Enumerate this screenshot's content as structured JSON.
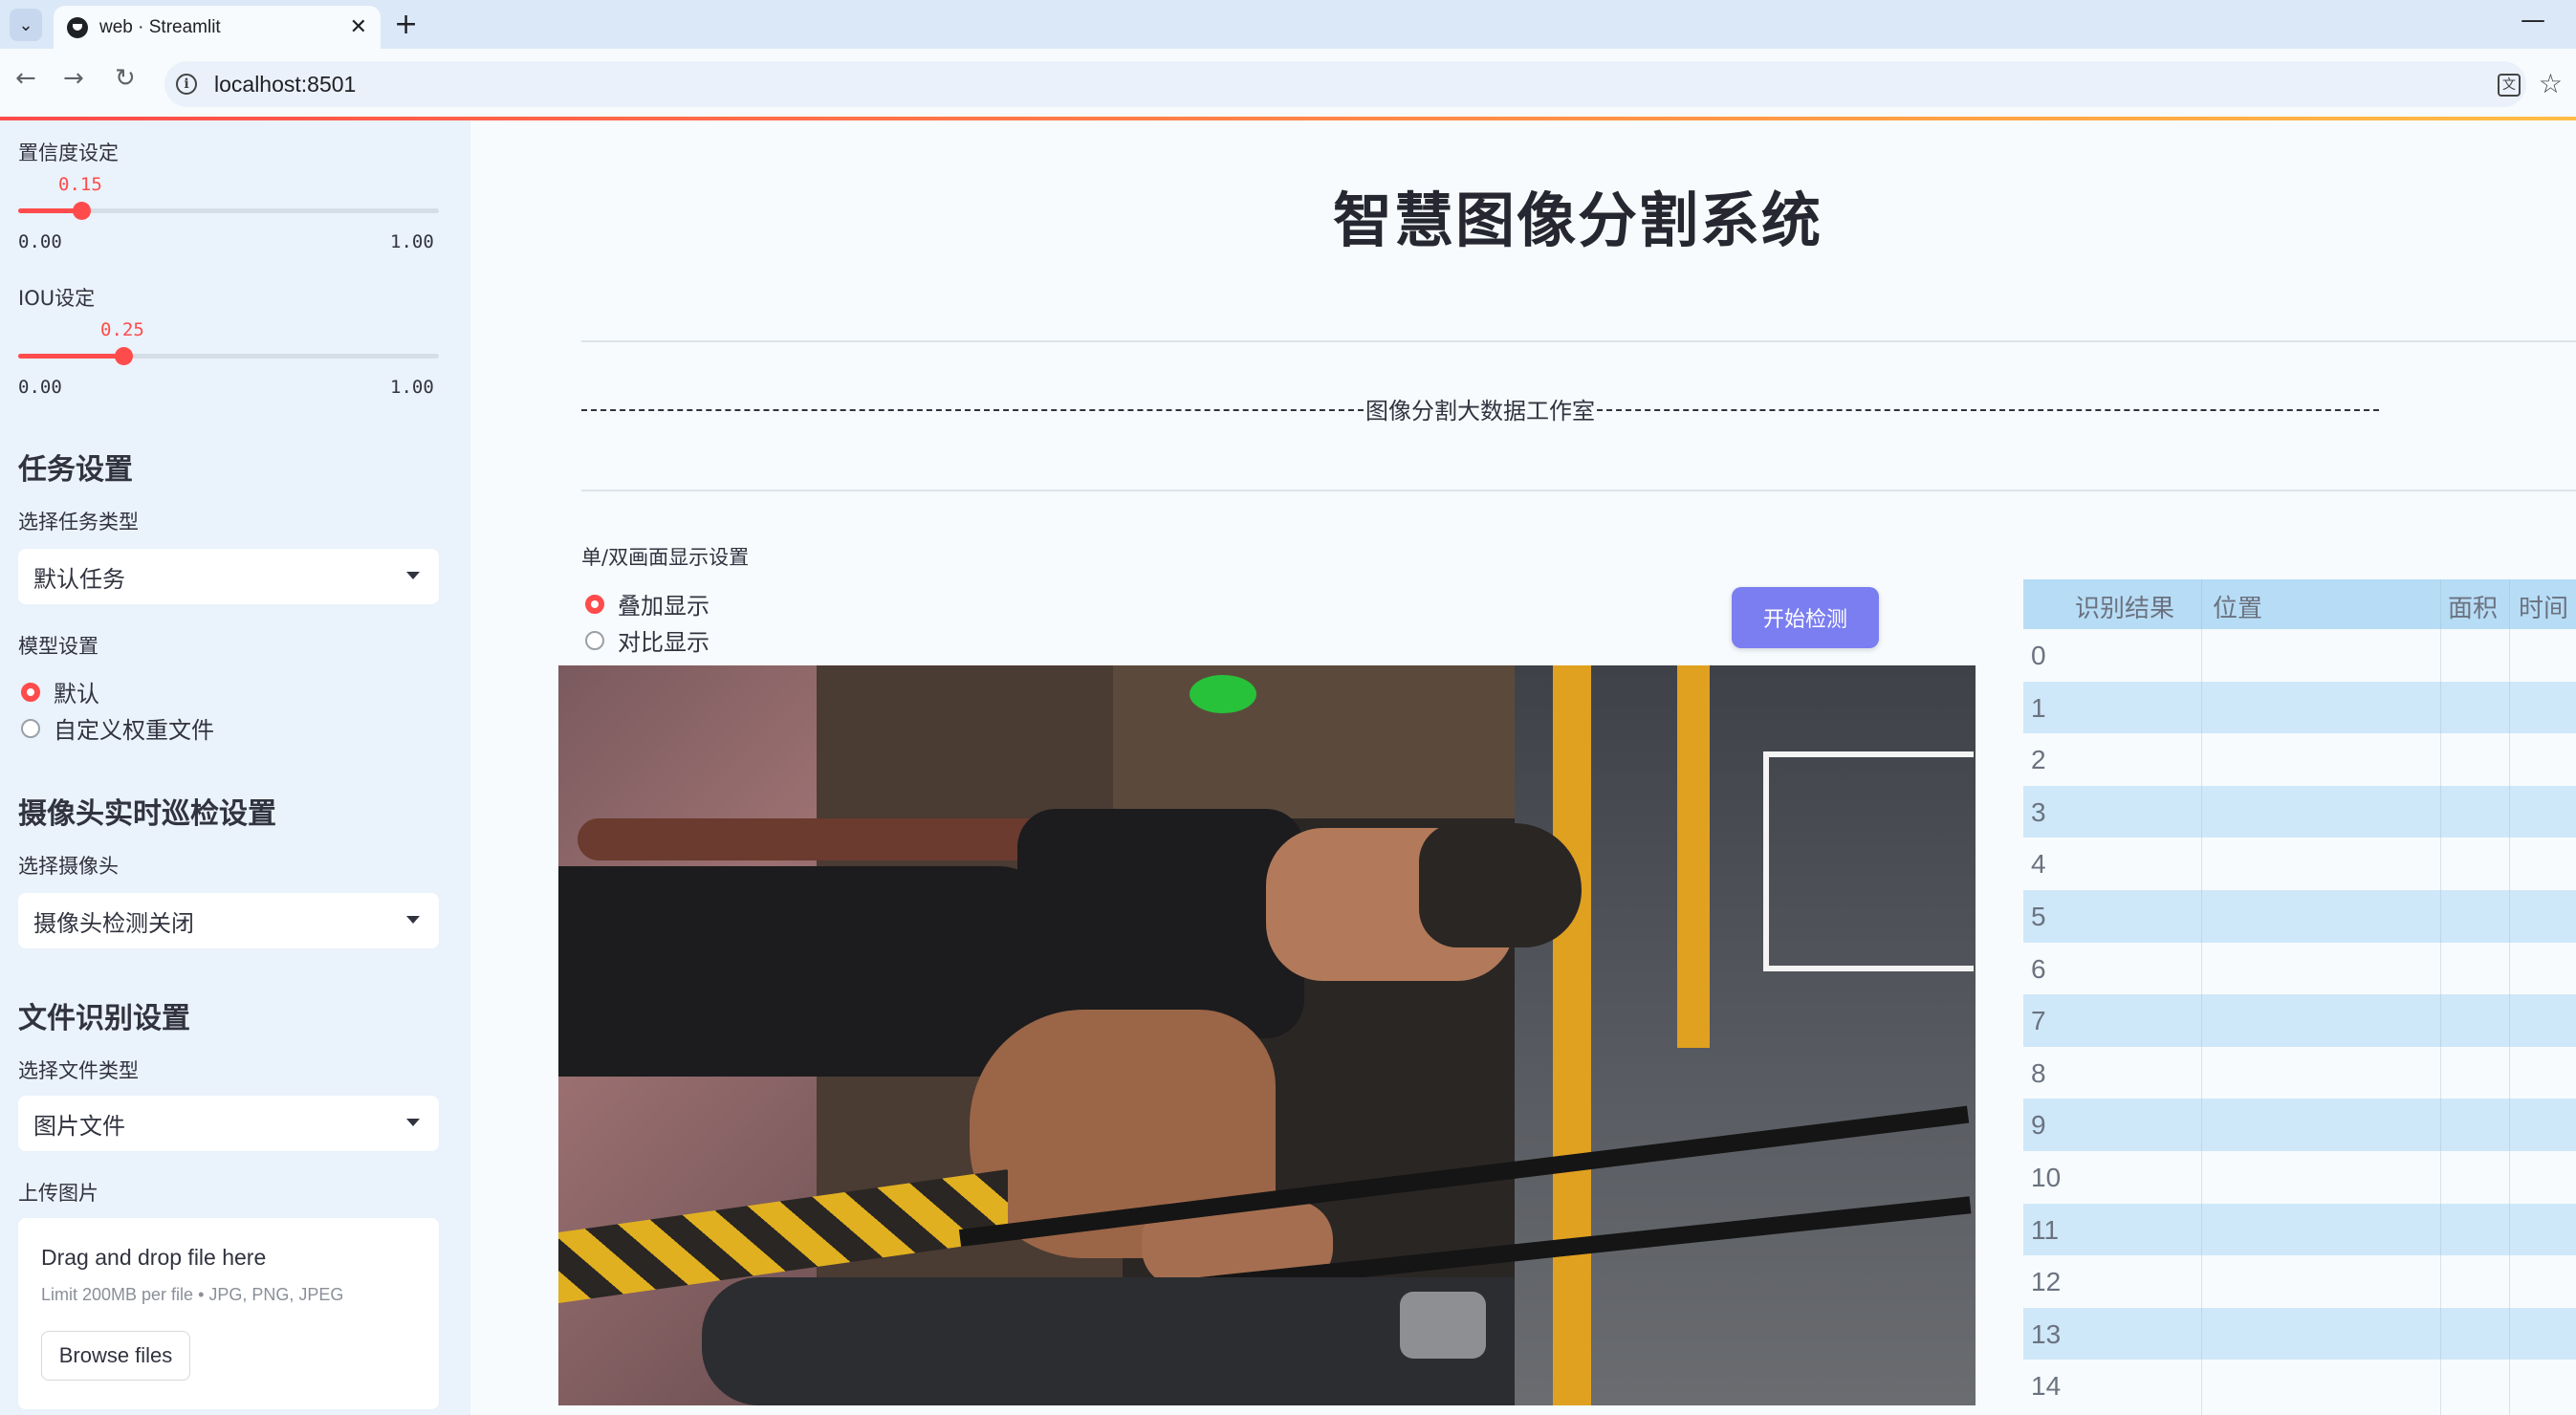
{
  "browser": {
    "tab_title": "web · Streamlit",
    "tab_close": "✕",
    "new_tab": "+",
    "minimize": "—",
    "url": "localhost:8501",
    "back": "←",
    "forward": "→",
    "reload": "↻",
    "star": "☆",
    "translate_glyph": "文"
  },
  "sidebar": {
    "confidence": {
      "label": "置信度设定",
      "value": "0.15",
      "min": "0.00",
      "max": "1.00",
      "fraction": 0.15
    },
    "iou": {
      "label": "IOU设定",
      "value": "0.25",
      "min": "0.00",
      "max": "1.00",
      "fraction": 0.25
    },
    "task": {
      "heading": "任务设置",
      "select_label": "选择任务类型",
      "selected": "默认任务"
    },
    "model": {
      "label": "模型设置",
      "options": [
        "默认",
        "自定义权重文件"
      ],
      "selected_index": 0
    },
    "camera": {
      "heading": "摄像头实时巡检设置",
      "select_label": "选择摄像头",
      "selected": "摄像头检测关闭"
    },
    "file": {
      "heading": "文件识别设置",
      "select_label": "选择文件类型",
      "selected": "图片文件",
      "upload_label": "上传图片"
    },
    "uploader": {
      "title": "Drag and drop file here",
      "limit": "Limit 200MB per file • JPG, PNG, JPEG",
      "button": "Browse files"
    }
  },
  "main": {
    "title": "智慧图像分割系统",
    "studio": "图像分割大数据工作室",
    "display_label": "单/双画面显示设置",
    "display_options": [
      "叠加显示",
      "对比显示"
    ],
    "display_selected_index": 0,
    "start_button": "开始检测"
  },
  "table": {
    "columns": [
      "识别结果",
      "位置",
      "面积",
      "时间"
    ],
    "rows": [
      "0",
      "1",
      "2",
      "3",
      "4",
      "5",
      "6",
      "7",
      "8",
      "9",
      "10",
      "11",
      "12",
      "13",
      "14"
    ]
  },
  "colors": {
    "accent": "#ff4b4b",
    "button": "#7b7ef0",
    "sidebar_bg": "#eaf2fb",
    "table_header": "#b7dcf5",
    "table_stripe": "#cfe8f9"
  }
}
